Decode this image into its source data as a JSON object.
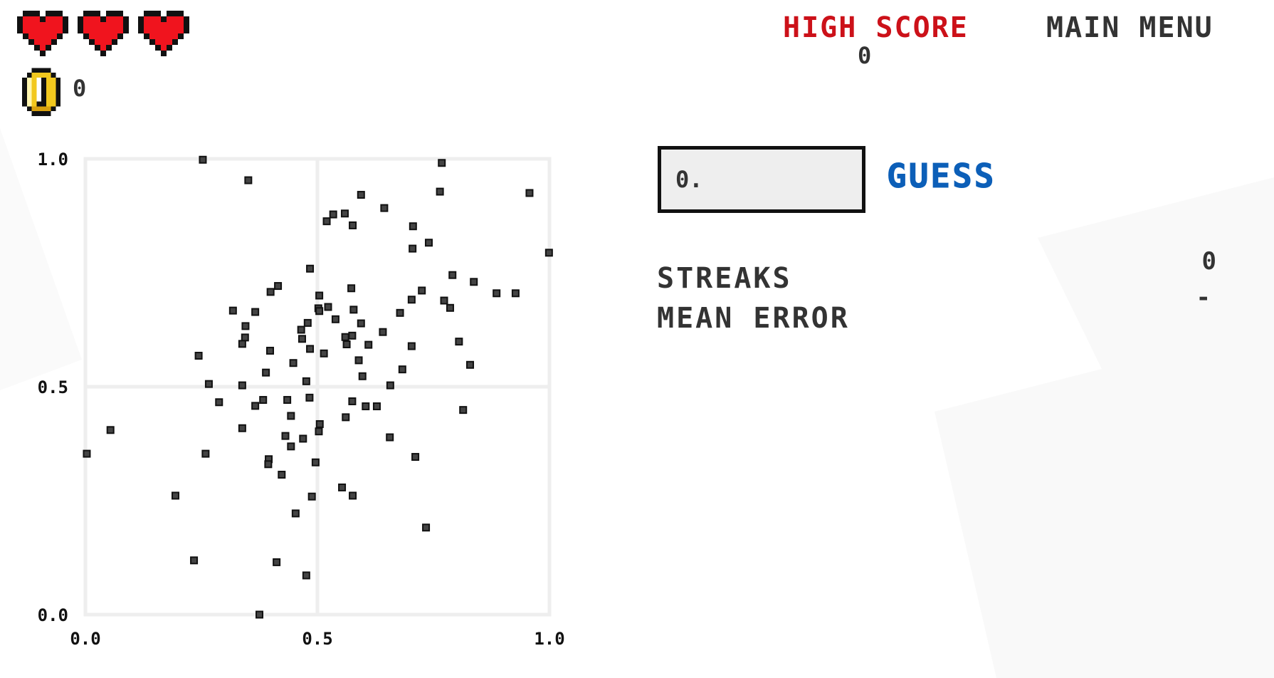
{
  "hud": {
    "lives": 3,
    "lives_max": 3,
    "coins": "0"
  },
  "header": {
    "high_score_label": "HIGH SCORE",
    "high_score_value": "0",
    "main_menu_label": "MAIN MENU"
  },
  "guess": {
    "input_value": "0.",
    "button_label": "GUESS"
  },
  "stats": [
    {
      "label": "STREAKS",
      "value": "0"
    },
    {
      "label": "MEAN ERROR",
      "value": "-"
    }
  ],
  "colors": {
    "heart": "#f0141e",
    "high_score": "#cc1119",
    "guess_button": "#0c5fb8",
    "text": "#333333",
    "point": "#222222",
    "grid": "#eeeeee",
    "input_bg": "#eeeeee",
    "coin": "#f2c81e"
  },
  "chart_data": {
    "type": "scatter",
    "title": "",
    "xlabel": "",
    "ylabel": "",
    "xlim": [
      0,
      1
    ],
    "ylim": [
      0,
      1
    ],
    "x_ticks": [
      "0.0",
      "0.5",
      "1.0"
    ],
    "y_ticks": [
      "0.0",
      "0.5",
      "1.0"
    ],
    "grid": true,
    "legend": "none",
    "points": [
      [
        0.253,
        0.998
      ],
      [
        0.351,
        0.953
      ],
      [
        0.484,
        0.759
      ],
      [
        0.415,
        0.721
      ],
      [
        0.399,
        0.708
      ],
      [
        0.504,
        0.7
      ],
      [
        0.318,
        0.667
      ],
      [
        0.366,
        0.664
      ],
      [
        0.502,
        0.672
      ],
      [
        0.504,
        0.666
      ],
      [
        0.479,
        0.64
      ],
      [
        0.345,
        0.633
      ],
      [
        0.465,
        0.625
      ],
      [
        0.344,
        0.608
      ],
      [
        0.467,
        0.605
      ],
      [
        0.338,
        0.594
      ],
      [
        0.484,
        0.583
      ],
      [
        0.398,
        0.579
      ],
      [
        0.244,
        0.568
      ],
      [
        0.448,
        0.552
      ],
      [
        0.389,
        0.531
      ],
      [
        0.476,
        0.512
      ],
      [
        0.266,
        0.506
      ],
      [
        0.338,
        0.503
      ],
      [
        0.768,
        0.991
      ],
      [
        0.764,
        0.928
      ],
      [
        0.957,
        0.925
      ],
      [
        0.594,
        0.921
      ],
      [
        0.644,
        0.892
      ],
      [
        0.534,
        0.878
      ],
      [
        0.559,
        0.88
      ],
      [
        0.52,
        0.863
      ],
      [
        0.576,
        0.854
      ],
      [
        0.706,
        0.852
      ],
      [
        0.74,
        0.816
      ],
      [
        0.705,
        0.803
      ],
      [
        0.999,
        0.794
      ],
      [
        0.791,
        0.745
      ],
      [
        0.837,
        0.73
      ],
      [
        0.573,
        0.716
      ],
      [
        0.725,
        0.711
      ],
      [
        0.886,
        0.705
      ],
      [
        0.927,
        0.705
      ],
      [
        0.703,
        0.691
      ],
      [
        0.773,
        0.689
      ],
      [
        0.523,
        0.675
      ],
      [
        0.578,
        0.669
      ],
      [
        0.786,
        0.673
      ],
      [
        0.678,
        0.662
      ],
      [
        0.539,
        0.648
      ],
      [
        0.594,
        0.639
      ],
      [
        0.641,
        0.62
      ],
      [
        0.56,
        0.609
      ],
      [
        0.575,
        0.612
      ],
      [
        0.563,
        0.593
      ],
      [
        0.61,
        0.592
      ],
      [
        0.703,
        0.589
      ],
      [
        0.805,
        0.599
      ],
      [
        0.514,
        0.573
      ],
      [
        0.589,
        0.558
      ],
      [
        0.829,
        0.548
      ],
      [
        0.683,
        0.538
      ],
      [
        0.597,
        0.523
      ],
      [
        0.657,
        0.503
      ],
      [
        0.288,
        0.466
      ],
      [
        0.383,
        0.471
      ],
      [
        0.366,
        0.458
      ],
      [
        0.435,
        0.471
      ],
      [
        0.483,
        0.476
      ],
      [
        0.443,
        0.436
      ],
      [
        0.054,
        0.405
      ],
      [
        0.338,
        0.409
      ],
      [
        0.431,
        0.392
      ],
      [
        0.469,
        0.386
      ],
      [
        0.443,
        0.369
      ],
      [
        0.505,
        0.418
      ],
      [
        0.503,
        0.402
      ],
      [
        0.003,
        0.353
      ],
      [
        0.259,
        0.353
      ],
      [
        0.395,
        0.341
      ],
      [
        0.394,
        0.33
      ],
      [
        0.496,
        0.334
      ],
      [
        0.423,
        0.307
      ],
      [
        0.194,
        0.261
      ],
      [
        0.488,
        0.259
      ],
      [
        0.453,
        0.222
      ],
      [
        0.234,
        0.119
      ],
      [
        0.412,
        0.115
      ],
      [
        0.476,
        0.086
      ],
      [
        0.375,
        0.0
      ],
      [
        0.575,
        0.468
      ],
      [
        0.604,
        0.457
      ],
      [
        0.628,
        0.457
      ],
      [
        0.814,
        0.449
      ],
      [
        0.561,
        0.433
      ],
      [
        0.656,
        0.389
      ],
      [
        0.711,
        0.346
      ],
      [
        0.553,
        0.279
      ],
      [
        0.576,
        0.261
      ],
      [
        0.734,
        0.191
      ]
    ]
  }
}
